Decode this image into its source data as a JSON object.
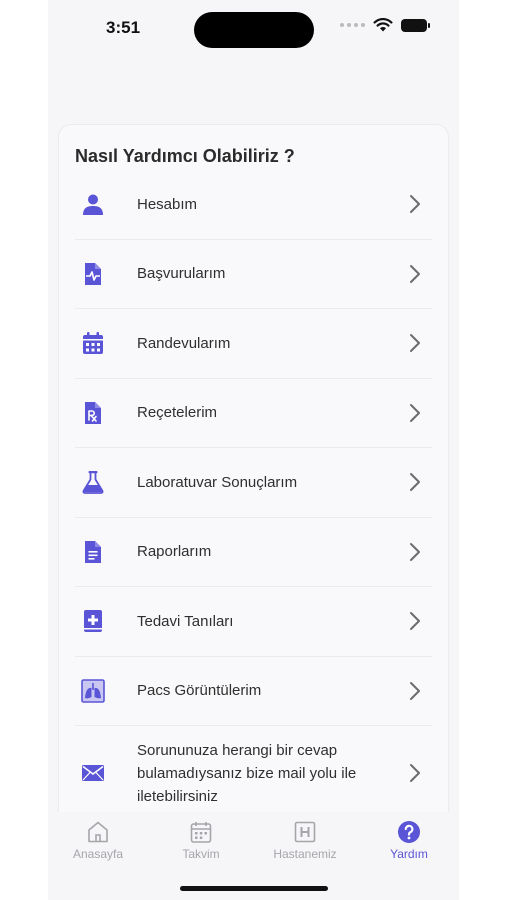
{
  "status_bar": {
    "time": "3:51"
  },
  "help": {
    "title": "Nasıl Yardımcı Olabiliriz ?",
    "items": [
      {
        "label": "Hesabım",
        "icon": "user-icon"
      },
      {
        "label": "Başvurularım",
        "icon": "medical-file-icon"
      },
      {
        "label": "Randevularım",
        "icon": "calendar-icon"
      },
      {
        "label": "Reçetelerim",
        "icon": "prescription-icon"
      },
      {
        "label": "Laboratuvar Sonuçlarım",
        "icon": "flask-icon"
      },
      {
        "label": "Raporlarım",
        "icon": "document-icon"
      },
      {
        "label": "Tedavi Tanıları",
        "icon": "medical-book-icon"
      },
      {
        "label": "Pacs Görüntülerim",
        "icon": "lungs-xray-icon"
      },
      {
        "label": "Sorununuza herangi bir cevap bulamadıysanız bize mail yolu ile iletebilirsiniz",
        "icon": "mail-icon"
      }
    ]
  },
  "tabs": [
    {
      "label": "Anasayfa",
      "icon": "home-icon",
      "active": false
    },
    {
      "label": "Takvim",
      "icon": "calendar-icon",
      "active": false
    },
    {
      "label": "Hastanemiz",
      "icon": "hospital-icon",
      "active": false
    },
    {
      "label": "Yardım",
      "icon": "help-icon",
      "active": true
    }
  ],
  "colors": {
    "accent": "#5a54d6",
    "inactive": "#a5a5ab"
  }
}
